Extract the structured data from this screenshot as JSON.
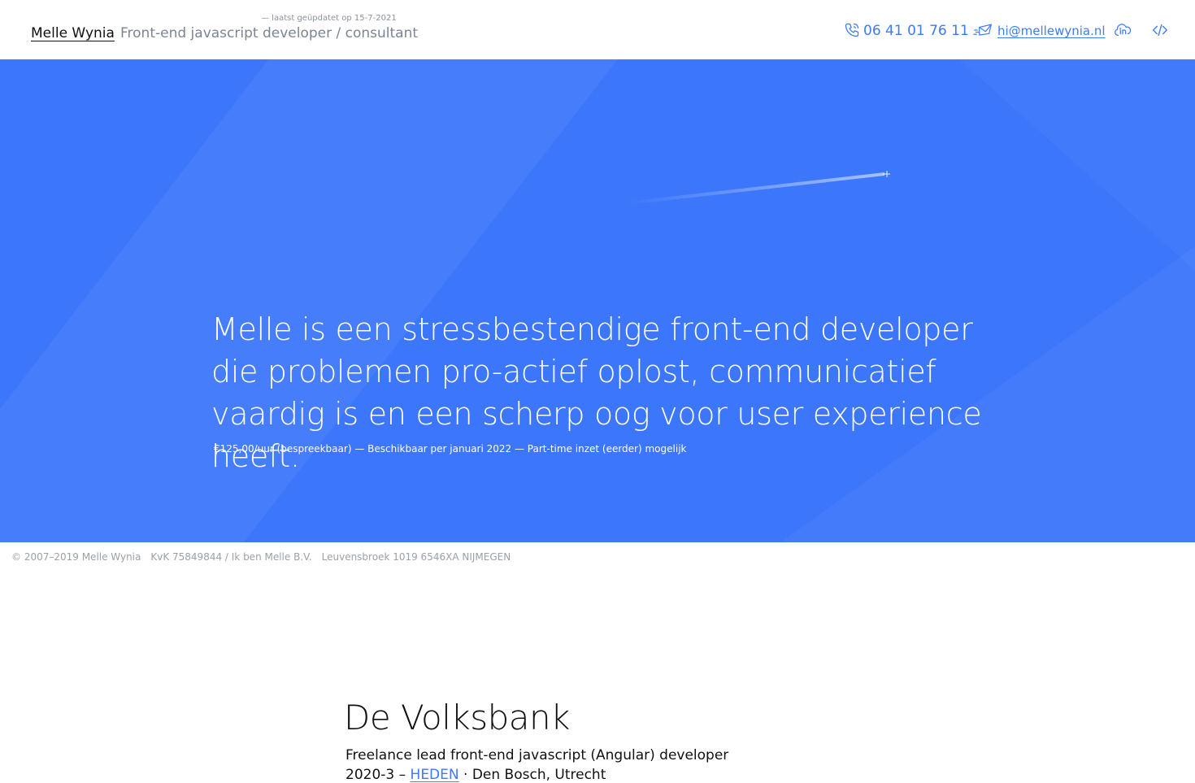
{
  "header": {
    "name": "Melle Wynia",
    "role": "Front-end javascript developer / consultant",
    "updated": "— laatst geüpdatet op 15-7-2021",
    "phone": "06 41 01 76 11",
    "email": "hi@mellewynia.nl",
    "icons": [
      "phone-icon",
      "mail-icon",
      "linkedin-icon",
      "code-icon"
    ],
    "accent_color": "#3d7bf7"
  },
  "hero": {
    "statement": "Melle is een stressbestendige front-end developer die problemen pro-actief oplost, communicatief vaardig is en een scherp oog voor user experience heeft.",
    "meta": "€125,00/uur (bespreekbaar) — Beschikbaar per januari 2022 — Part-time inzet (eerder) mogelijk",
    "background_color": "#3b76fb"
  },
  "footer": {
    "copyright": "© 2007–2019 Melle Wynia",
    "kvk": "KvK 75849844 / Ik ben Melle B.V.",
    "address": "Leuvensbroek 1019 6546XA NIJMEGEN"
  },
  "experience": {
    "company": "De Volksbank",
    "role": "Freelance lead front-end javascript (Angular) developer",
    "period_start": "2020-3 –",
    "period_end": "HEDEN",
    "location": "· Den Bosch, Utrecht"
  }
}
